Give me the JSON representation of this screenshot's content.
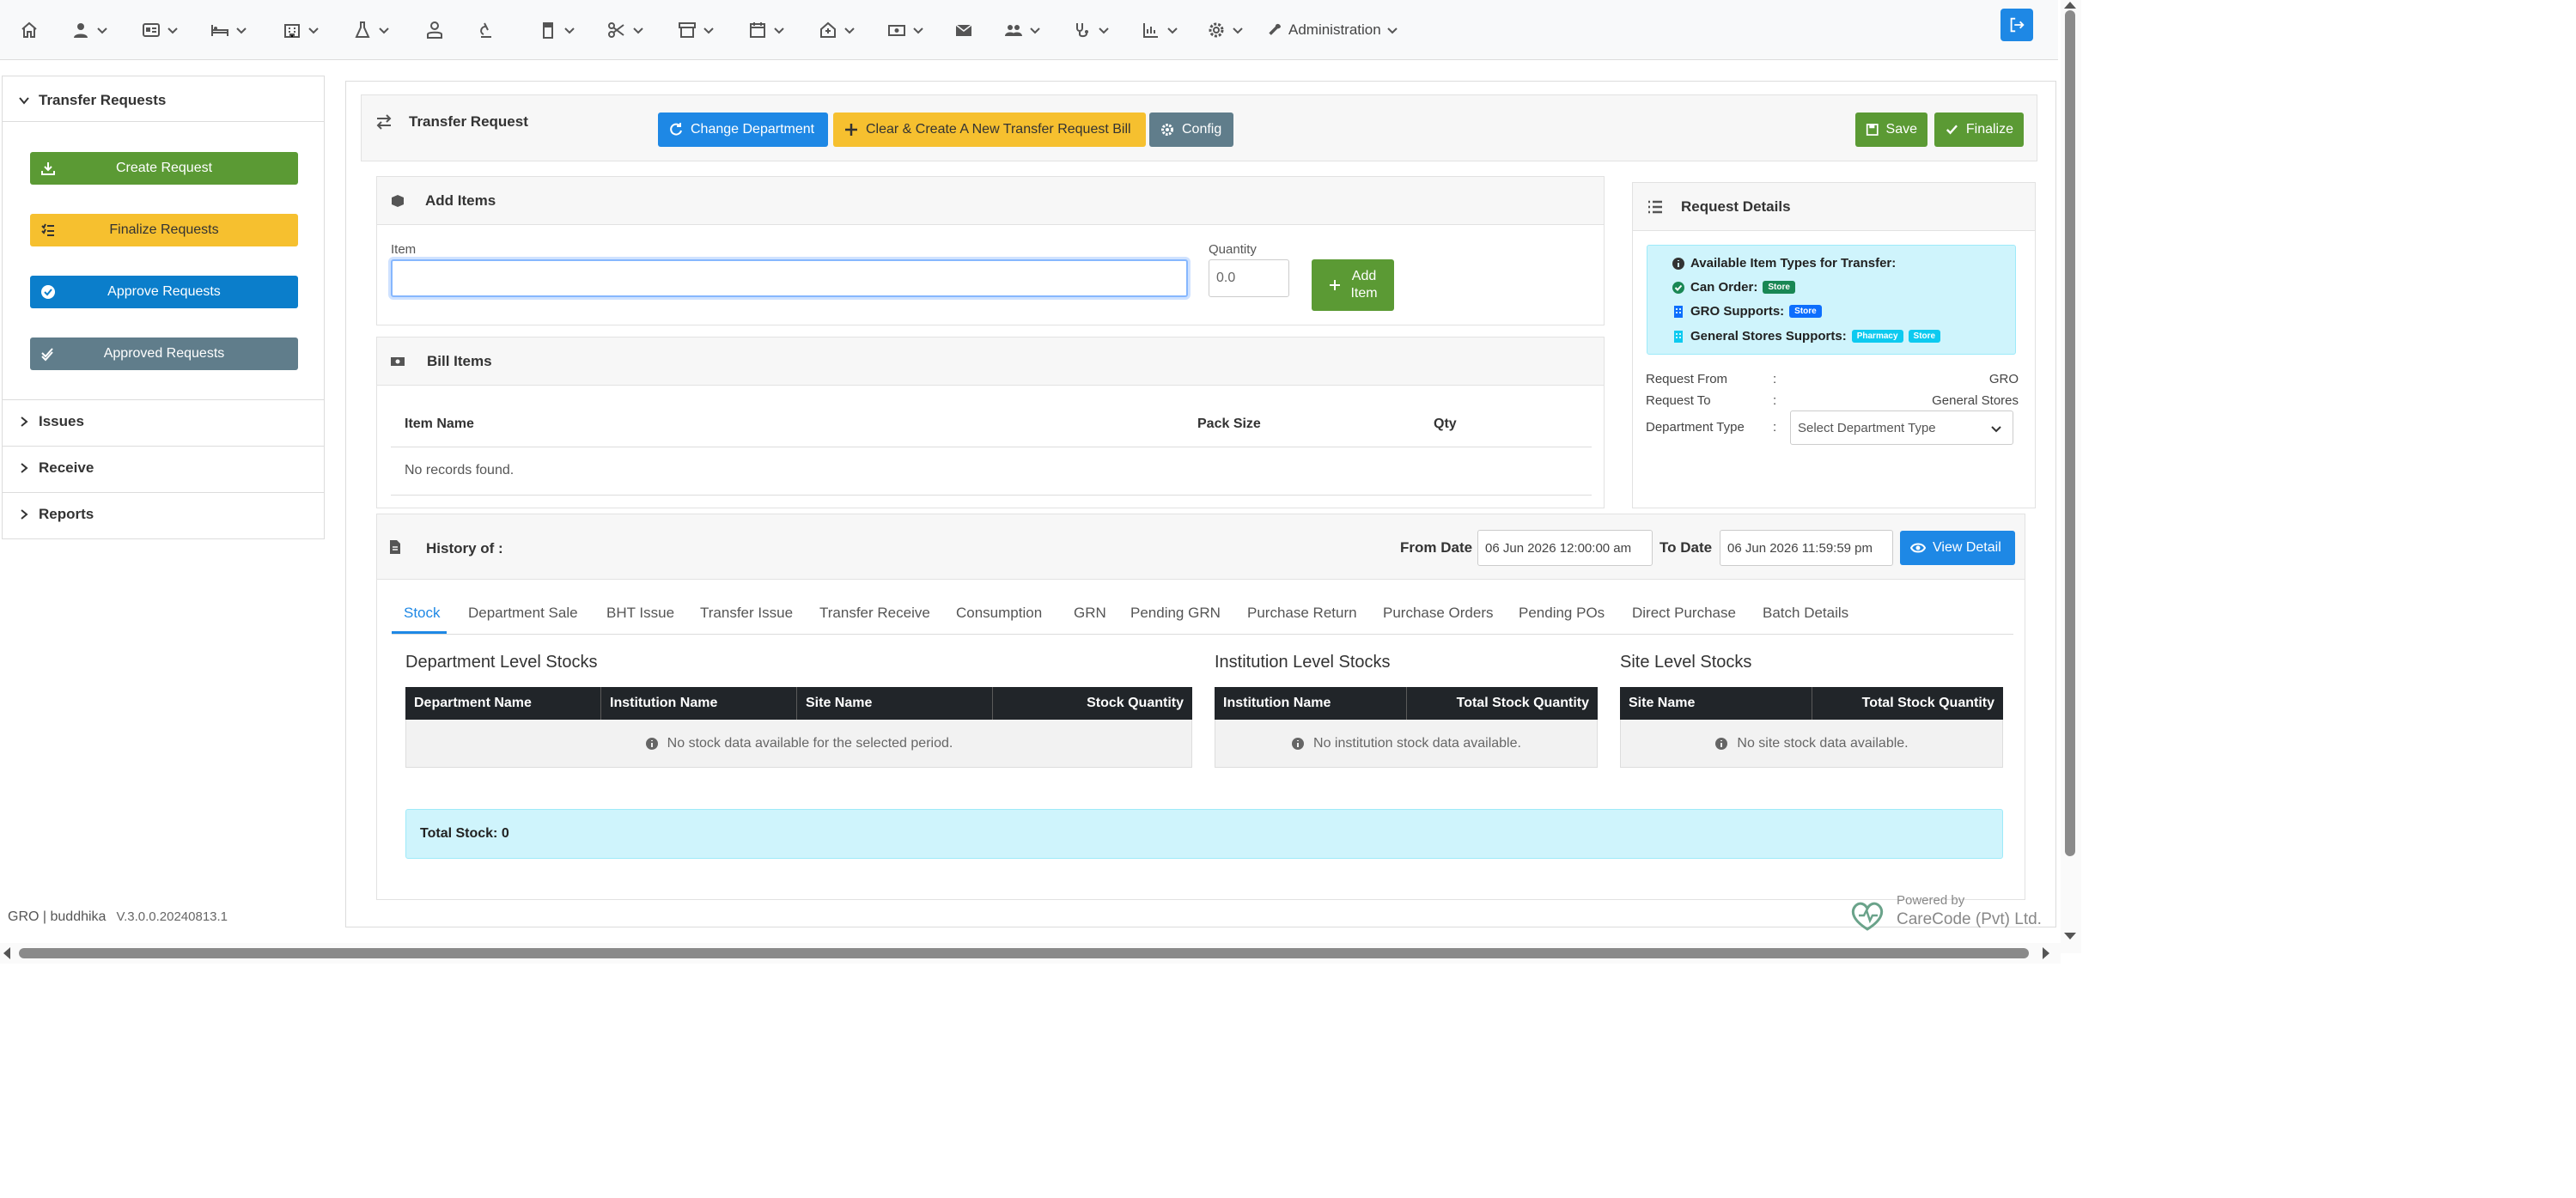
{
  "nav": {
    "admin_label": "Administration"
  },
  "sidebar": {
    "transfer_requests": "Transfer Requests",
    "buttons": {
      "create": "Create Request",
      "finalize": "Finalize Requests",
      "approve": "Approve Requests",
      "approved": "Approved Requests"
    },
    "issues": "Issues",
    "receive": "Receive",
    "reports": "Reports"
  },
  "footer": {
    "user": "GRO | buddhika",
    "version": "V.3.0.0.20240813.1",
    "powered_by": "Powered by",
    "company": "CareCode (Pvt) Ltd."
  },
  "header": {
    "title": "Transfer Request",
    "change_department": "Change Department",
    "clear_create": "Clear & Create A New Transfer Request Bill",
    "config": "Config",
    "save": "Save",
    "finalize": "Finalize"
  },
  "add_items": {
    "title": "Add Items",
    "item_label": "Item",
    "item_value": "",
    "quantity_label": "Quantity",
    "quantity_value": "0.0",
    "add_button_line1": "Add",
    "add_button_line2": "Item"
  },
  "bill_items": {
    "title": "Bill Items",
    "columns": [
      "Item Name",
      "Pack Size",
      "Qty"
    ],
    "empty": "No records found."
  },
  "request_details": {
    "title": "Request Details",
    "available_types": "Available Item Types for Transfer:",
    "can_order": "Can Order:",
    "can_order_badge": "Store",
    "gro_supports": "GRO Supports:",
    "gro_badge": "Store",
    "general_supports": "General Stores Supports:",
    "general_badges": [
      "Pharmacy",
      "Store"
    ],
    "request_from_label": "Request From",
    "request_from_value": "GRO",
    "request_to_label": "Request To",
    "request_to_value": "General Stores",
    "department_type_label": "Department Type",
    "department_type_placeholder": "Select Department Type",
    "colon": ":"
  },
  "history": {
    "title": "History of :",
    "from_label": "From Date",
    "from_value": "06 Jun 2026 12:00:00 am",
    "to_label": "To Date",
    "to_value": "06 Jun 2026 11:59:59 pm",
    "view_detail": "View Detail",
    "tabs": [
      "Stock",
      "Department Sale",
      "BHT Issue",
      "Transfer Issue",
      "Transfer Receive",
      "Consumption",
      "GRN",
      "Pending GRN",
      "Purchase Return",
      "Purchase Orders",
      "Pending POs",
      "Direct Purchase",
      "Batch Details"
    ],
    "dept_title": "Department Level Stocks",
    "dept_columns": [
      "Department Name",
      "Institution Name",
      "Site Name",
      "Stock Quantity"
    ],
    "dept_empty": "No stock data available for the selected period.",
    "inst_title": "Institution Level Stocks",
    "inst_columns": [
      "Institution Name",
      "Total Stock Quantity"
    ],
    "inst_empty": "No institution stock data available.",
    "site_title": "Site Level Stocks",
    "site_columns": [
      "Site Name",
      "Total Stock Quantity"
    ],
    "site_empty": "No site stock data available.",
    "total_stock": "Total Stock: 0"
  },
  "colors": {
    "primary": "#1e88e5",
    "success": "#5b9a34",
    "warning": "#f6c02f",
    "info_bg": "#cff4fc",
    "dark": "#212529",
    "secondary": "#607d8b"
  }
}
